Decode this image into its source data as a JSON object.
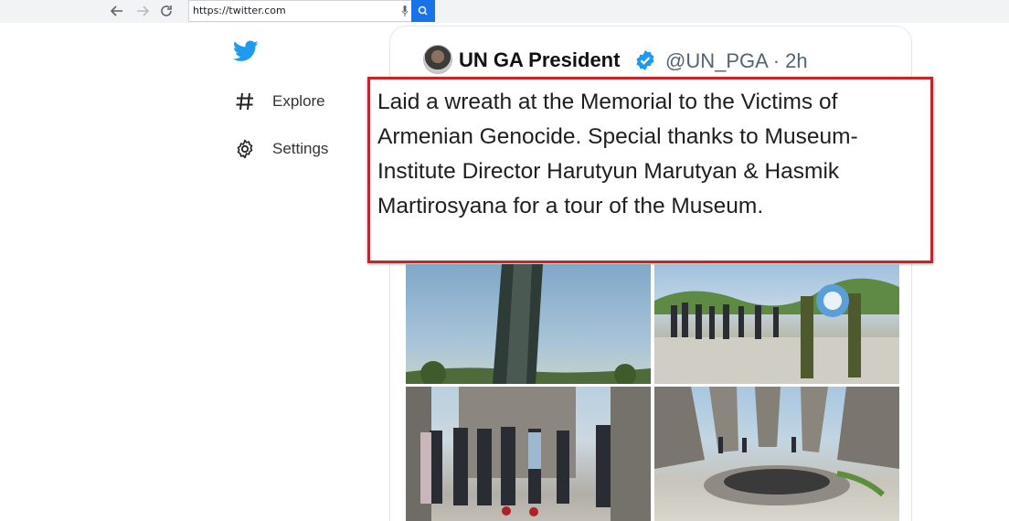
{
  "browser": {
    "back_icon": "arrow-left-icon",
    "forward_icon": "arrow-right-icon",
    "reload_icon": "reload-icon",
    "url": "https://twitter.com",
    "mic_icon": "microphone-icon",
    "search_icon": "search-icon",
    "accent": "#1a73e8"
  },
  "sidebar": {
    "logo_icon": "twitter-bird-icon",
    "items": [
      {
        "label": "Explore",
        "icon": "hashtag-icon"
      },
      {
        "label": "Settings",
        "icon": "gear-icon"
      }
    ]
  },
  "tweet": {
    "author_name": "UN GA President",
    "verified_icon": "verified-badge-icon",
    "handle": "@UN_PGA · 2h",
    "text": "Laid a wreath at the Memorial to the Victims of Armenian Genocide. Special thanks to Museum-Institute Director Harutyun Marutyan & Hasmik Martirosyana for a tour of the Museum.",
    "highlight_color": "#c8232b",
    "photos": 4
  }
}
